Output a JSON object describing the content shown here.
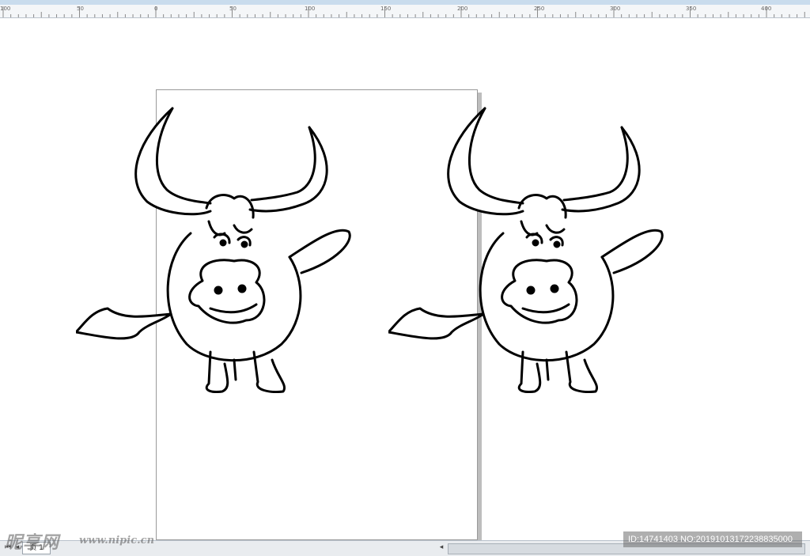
{
  "ruler": {
    "labels": [
      "100",
      "50",
      "0",
      "50",
      "100",
      "150",
      "200",
      "250",
      "300",
      "350",
      "400"
    ]
  },
  "statusbar": {
    "page_tab": "页 1"
  },
  "watermark": {
    "logo": "昵享网",
    "url": "www.nipic.cn",
    "id_text": "ID:14741403 NO:20191013172238835000"
  },
  "icons": {
    "nav_first": "first-page-icon",
    "nav_prev": "prev-icon",
    "scroll_left": "scroll-left-icon"
  }
}
